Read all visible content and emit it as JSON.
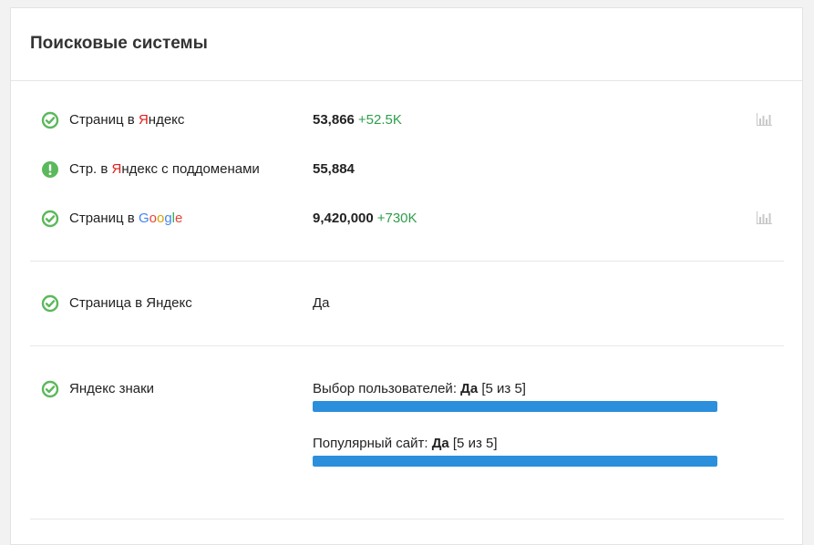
{
  "title": "Поисковые системы",
  "colors": {
    "ok": "#5cb85c",
    "warn": "#5cb85c",
    "yandex_red": "#e0201b",
    "delta_green": "#2e9e4a",
    "bar": "#2b8fdc"
  },
  "rows": [
    {
      "icon": "check-circle-icon",
      "label_pre": "Страниц в ",
      "label_brand_first": "Я",
      "label_brand_rest": "ндекс",
      "value": "53,866",
      "delta": "+52.5K",
      "has_chart": true
    },
    {
      "icon": "exclamation-circle-icon",
      "label_pre": "Стр. в ",
      "label_brand_first": "Я",
      "label_brand_rest": "ндекс с поддоменами",
      "value": "55,884",
      "delta": "",
      "has_chart": false
    },
    {
      "icon": "check-circle-icon",
      "label_pre": "Страниц в ",
      "google": [
        "G",
        "o",
        "o",
        "g",
        "l",
        "e"
      ],
      "value": "9,420,000",
      "delta": "+730K",
      "has_chart": true
    }
  ],
  "yandex_page": {
    "icon": "check-circle-icon",
    "label": "Страница в Яндекс",
    "value": "Да"
  },
  "yandex_signs": {
    "icon": "check-circle-icon",
    "label": "Яндекс знаки",
    "items": [
      {
        "label": "Выбор пользователей:",
        "value": "Да",
        "score": "[5 из 5]",
        "level": 5,
        "max": 5
      },
      {
        "label": "Популярный сайт:",
        "value": "Да",
        "score": "[5 из 5]",
        "level": 5,
        "max": 5
      }
    ]
  }
}
